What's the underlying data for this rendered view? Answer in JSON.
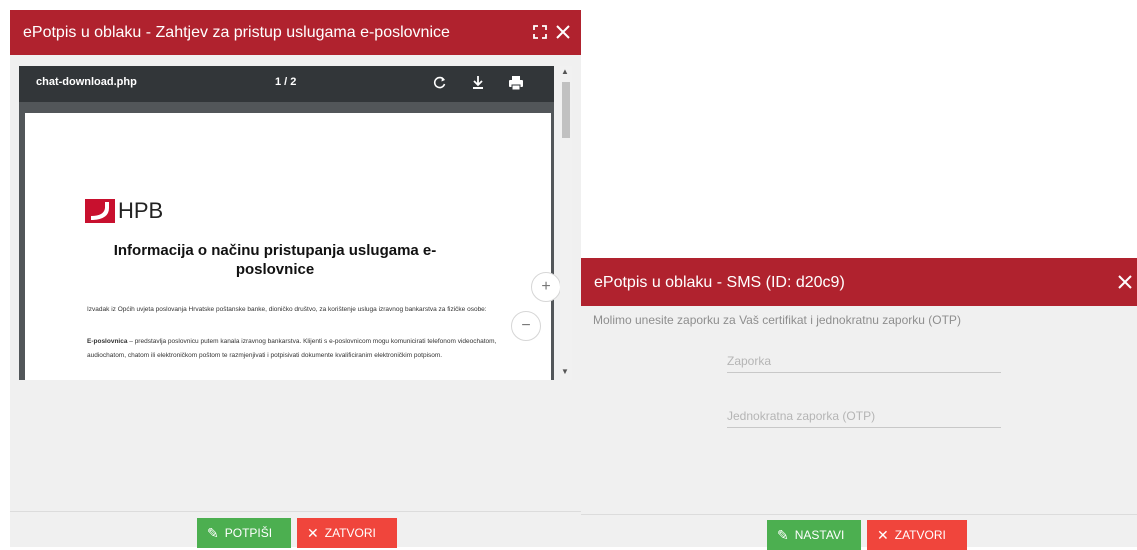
{
  "left_dialog": {
    "title": "ePotpis u oblaku - Zahtjev za pristup uslugama e-poslovnice",
    "viewer": {
      "filename": "chat-download.php",
      "pages": "1 / 2"
    },
    "document": {
      "logo_text": "HPB",
      "heading": "Informacija o načinu pristupanja uslugama e-poslovnice",
      "paragraph1": "Izvadak iz Općih uvjeta poslovanja Hrvatske poštanske banke, dioničko društvo, za korištenje usluga izravnog bankarstva za fizičke osobe:",
      "paragraph2_bold": "E-poslovnica",
      "paragraph2": " – predstavlja poslovnicu putem kanala izravnog bankarstva. Klijenti s e-poslovnicom mogu komunicirati telefonom videochatom, audiochatom, chatom ili elektroničkom poštom te razmjenjivati i potpisivati dokumente kvalificiranim elektroničkim potpisom."
    },
    "buttons": {
      "sign": "POTPIŠI",
      "close": "ZATVORI"
    }
  },
  "right_dialog": {
    "title": "ePotpis u oblaku - SMS (ID: d20c9)",
    "instruction": "Molimo unesite zaporku za Vaš certifikat i jednokratnu zaporku (OTP)",
    "password_placeholder": "Zaporka",
    "otp_placeholder": "Jednokratna zaporka (OTP)",
    "buttons": {
      "continue": "NASTAVI",
      "close": "ZATVORI"
    }
  },
  "colors": {
    "titlebar": "#b0222e",
    "green_button": "#4caf50",
    "red_button": "#f0453c"
  }
}
